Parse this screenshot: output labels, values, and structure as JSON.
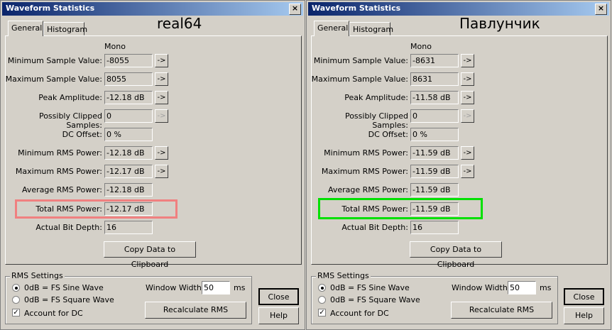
{
  "window_title": "Waveform Statistics",
  "close_glyph": "×",
  "tabs": [
    "General",
    "Histogram"
  ],
  "channel_label": "Mono",
  "arrow_label": "->",
  "rows": [
    "Minimum Sample Value:",
    "Maximum Sample Value:",
    "Peak Amplitude:",
    "Possibly Clipped Samples:",
    "DC Offset:",
    "Minimum RMS Power:",
    "Maximum RMS Power:",
    "Average RMS Power:",
    "Total RMS Power:",
    "Actual Bit Depth:"
  ],
  "copy_button": "Copy Data to Clipboard",
  "rms_settings": {
    "title": "RMS Settings",
    "option_sine": "0dB = FS Sine Wave",
    "option_square": "0dB = FS Square Wave",
    "account_dc": "Account for DC",
    "window_width_label": "Window Width:",
    "window_width_value": "50",
    "unit": "ms",
    "recalc_button": "Recalculate RMS"
  },
  "buttons": {
    "close": "Close",
    "help": "Help"
  },
  "left": {
    "caption": "real64",
    "values": [
      "-8055",
      "8055",
      "-12.18 dB",
      "0",
      "0 %",
      "-12.18 dB",
      "-12.17 dB",
      "-12.18 dB",
      "-12.17 dB",
      "16"
    ],
    "highlight_color": "#f08080"
  },
  "right": {
    "caption": "Павлунчик",
    "values": [
      "-8631",
      "8631",
      "-11.58 dB",
      "0",
      "0 %",
      "-11.59 dB",
      "-11.59 dB",
      "-11.59 dB",
      "-11.59 dB",
      "16"
    ],
    "highlight_color": "#00e000"
  }
}
